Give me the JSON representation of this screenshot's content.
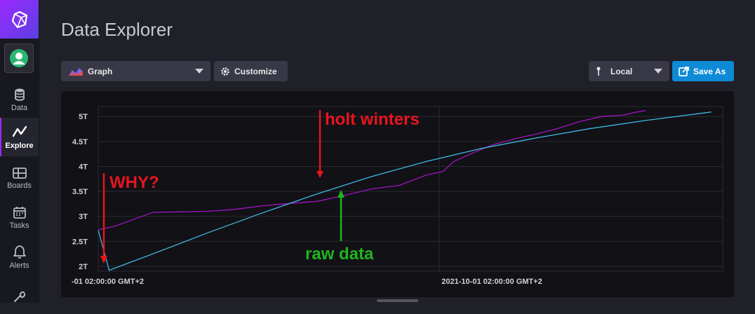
{
  "sidebar": {
    "logo_icon": "influxdb-cube-icon",
    "avatar_icon": "user-avatar-icon",
    "items": [
      {
        "label": "Data",
        "icon": "database-icon"
      },
      {
        "label": "Explore",
        "icon": "graph-line-icon",
        "active": true
      },
      {
        "label": "Boards",
        "icon": "dashboard-grid-icon"
      },
      {
        "label": "Tasks",
        "icon": "calendar-icon"
      },
      {
        "label": "Alerts",
        "icon": "bell-icon"
      }
    ]
  },
  "header": {
    "title": "Data Explorer"
  },
  "toolbar": {
    "visualization": "Graph",
    "customize_label": "Customize",
    "timezone": "Local",
    "save_as_label": "Save As",
    "save_color": "#0f8ad6"
  },
  "chart_data": {
    "type": "line",
    "y_tick_labels": [
      "2T",
      "2.5T",
      "3T",
      "3.5T",
      "4T",
      "4.5T",
      "5T"
    ],
    "ylim": [
      1.9,
      5.2
    ],
    "x_tick_labels": [
      "-01 02:00:00 GMT+2",
      "2021-10-01 02:00:00 GMT+2"
    ],
    "grid": true,
    "series": [
      {
        "color": "#a214c0",
        "points": [
          [
            0,
            2.73
          ],
          [
            0.03,
            2.8
          ],
          [
            0.05,
            2.88
          ],
          [
            0.08,
            3.0
          ],
          [
            0.1,
            3.08
          ],
          [
            0.15,
            3.09
          ],
          [
            0.2,
            3.1
          ],
          [
            0.25,
            3.14
          ],
          [
            0.3,
            3.21
          ],
          [
            0.35,
            3.26
          ],
          [
            0.4,
            3.3
          ],
          [
            0.45,
            3.42
          ],
          [
            0.5,
            3.55
          ],
          [
            0.55,
            3.62
          ],
          [
            0.6,
            3.83
          ],
          [
            0.63,
            3.9
          ],
          [
            0.65,
            4.1
          ],
          [
            0.68,
            4.25
          ],
          [
            0.72,
            4.43
          ],
          [
            0.76,
            4.55
          ],
          [
            0.8,
            4.65
          ],
          [
            0.84,
            4.76
          ],
          [
            0.88,
            4.9
          ],
          [
            0.92,
            5.0
          ],
          [
            0.96,
            5.03
          ],
          [
            0.98,
            5.08
          ],
          [
            1.0,
            5.12
          ]
        ]
      },
      {
        "color": "#3fb8e0",
        "points": [
          [
            0,
            2.72
          ],
          [
            0.02,
            1.92
          ],
          [
            0.1,
            2.25
          ],
          [
            0.2,
            2.67
          ],
          [
            0.3,
            3.07
          ],
          [
            0.4,
            3.45
          ],
          [
            0.5,
            3.8
          ],
          [
            0.6,
            4.1
          ],
          [
            0.7,
            4.36
          ],
          [
            0.8,
            4.57
          ],
          [
            0.9,
            4.76
          ],
          [
            1.0,
            4.92
          ],
          [
            1.12,
            5.09
          ]
        ]
      }
    ],
    "annotations": [
      {
        "text": "holt winters",
        "color": "#e8141e"
      },
      {
        "text": "WHY?",
        "color": "#e8141e"
      },
      {
        "text": "raw data",
        "color": "#1fb51f"
      }
    ]
  }
}
